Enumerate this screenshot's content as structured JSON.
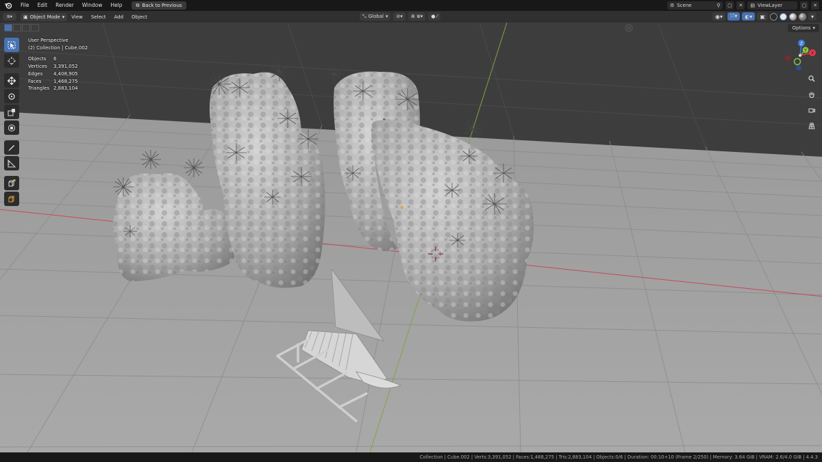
{
  "menu": {
    "items": [
      "File",
      "Edit",
      "Render",
      "Window",
      "Help"
    ],
    "back_button": "Back to Previous"
  },
  "workspace": {
    "scene": "Scene",
    "view_layer": "ViewLayer"
  },
  "viewport_header": {
    "mode": "Object Mode",
    "menus": [
      "View",
      "Select",
      "Add",
      "Object"
    ],
    "orientation": "Global",
    "options": "Options"
  },
  "overlay": {
    "view_name": "User Perspective",
    "collection_line": "(2) Collection | Cube.002",
    "stats": [
      {
        "label": "Objects",
        "value": "6"
      },
      {
        "label": "Vertices",
        "value": "3,391,052"
      },
      {
        "label": "Edges",
        "value": "4,408,905"
      },
      {
        "label": "Faces",
        "value": "1,468,275"
      },
      {
        "label": "Triangles",
        "value": "2,883,104"
      }
    ]
  },
  "gizmo": {
    "axes": [
      "X",
      "Y",
      "Z"
    ],
    "colors": {
      "x": "#e8374b",
      "y": "#8bc53f",
      "z": "#3f7fe0"
    }
  },
  "status_bar": {
    "text": "Collection | Cube.002 | Verts:3,391,052 | Faces:1,468,275 | Tris:2,883,104 | Objects:0/6 | Duration: 00:10+10 (Frame 2/250) | Memory: 3.64 GiB | VRAM: 2.6/4.0 GiB | 4.4.3"
  },
  "icons": [
    "blender-logo-icon",
    "select-box-icon",
    "cursor-icon",
    "move-icon",
    "rotate-icon",
    "scale-icon",
    "transform-icon",
    "annotate-icon",
    "measure-icon",
    "add-cube-icon",
    "camera-icon",
    "zoom-icon",
    "hand-icon",
    "persp-icon"
  ]
}
